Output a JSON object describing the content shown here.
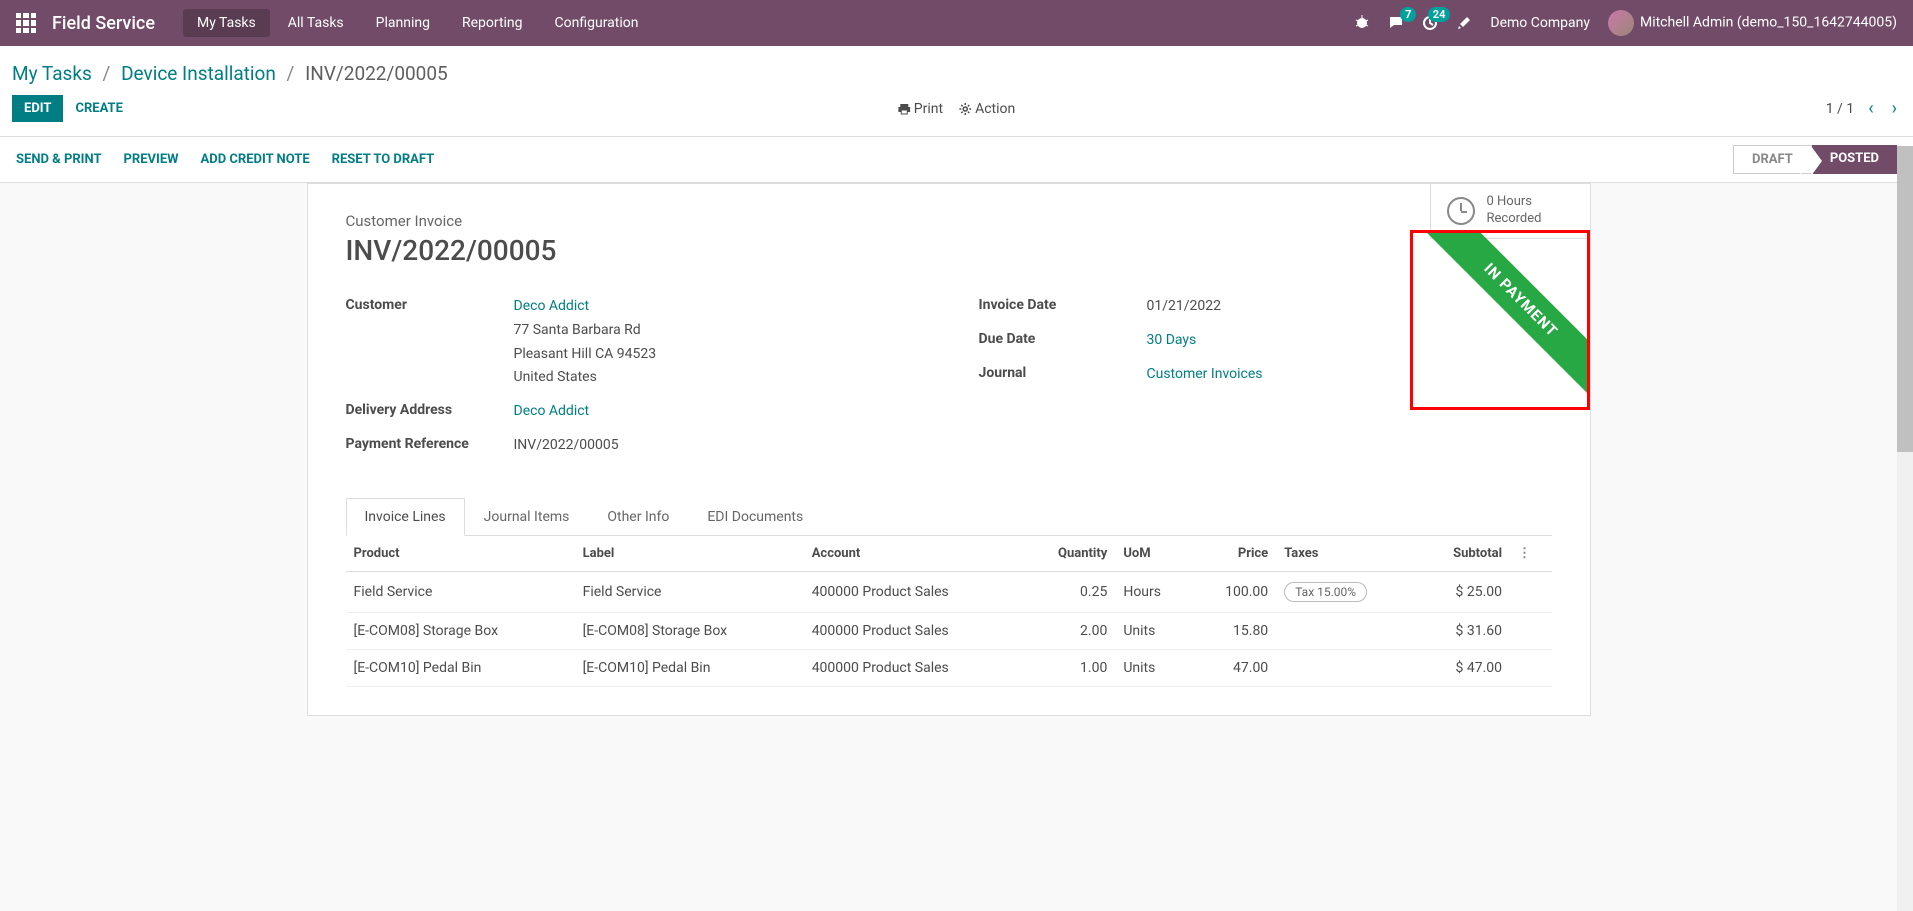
{
  "nav": {
    "brand": "Field Service",
    "links": [
      "My Tasks",
      "All Tasks",
      "Planning",
      "Reporting",
      "Configuration"
    ],
    "msg_badge": "7",
    "activity_badge": "24",
    "company": "Demo Company",
    "user": "Mitchell Admin (demo_150_1642744005)"
  },
  "breadcrumb": {
    "items": [
      "My Tasks",
      "Device Installation"
    ],
    "current": "INV/2022/00005"
  },
  "control": {
    "edit": "EDIT",
    "create": "CREATE",
    "print": "Print",
    "action": "Action",
    "pager": "1 / 1"
  },
  "statusbar": {
    "actions": [
      "SEND & PRINT",
      "PREVIEW",
      "ADD CREDIT NOTE",
      "RESET TO DRAFT"
    ],
    "statuses": {
      "draft": "DRAFT",
      "posted": "POSTED"
    }
  },
  "stat": {
    "line1": "0 Hours",
    "line2": "Recorded"
  },
  "ribbon": "IN PAYMENT",
  "doc": {
    "type": "Customer Invoice",
    "name": "INV/2022/00005",
    "customer": "Deco Addict",
    "addr1": "77 Santa Barbara Rd",
    "addr2": "Pleasant Hill CA 94523",
    "addr3": "United States",
    "delivery_label": "Delivery Address",
    "delivery": "Deco Addict",
    "payref_label": "Payment Reference",
    "payref": "INV/2022/00005",
    "invoice_date_label": "Invoice Date",
    "invoice_date": "01/21/2022",
    "due_date_label": "Due Date",
    "due_date": "30 Days",
    "journal_label": "Journal",
    "journal": "Customer Invoices",
    "customer_label": "Customer"
  },
  "tabs": [
    "Invoice Lines",
    "Journal Items",
    "Other Info",
    "EDI Documents"
  ],
  "table": {
    "headers": {
      "product": "Product",
      "label": "Label",
      "account": "Account",
      "qty": "Quantity",
      "uom": "UoM",
      "price": "Price",
      "taxes": "Taxes",
      "subtotal": "Subtotal"
    },
    "rows": [
      {
        "product": "Field Service",
        "label": "Field Service",
        "account": "400000 Product Sales",
        "qty": "0.25",
        "uom": "Hours",
        "price": "100.00",
        "tax": "Tax 15.00%",
        "subtotal": "$ 25.00"
      },
      {
        "product": "[E-COM08] Storage Box",
        "label": "[E-COM08] Storage Box",
        "account": "400000 Product Sales",
        "qty": "2.00",
        "uom": "Units",
        "price": "15.80",
        "tax": "",
        "subtotal": "$ 31.60"
      },
      {
        "product": "[E-COM10] Pedal Bin",
        "label": "[E-COM10] Pedal Bin",
        "account": "400000 Product Sales",
        "qty": "1.00",
        "uom": "Units",
        "price": "47.00",
        "tax": "",
        "subtotal": "$ 47.00"
      }
    ]
  }
}
